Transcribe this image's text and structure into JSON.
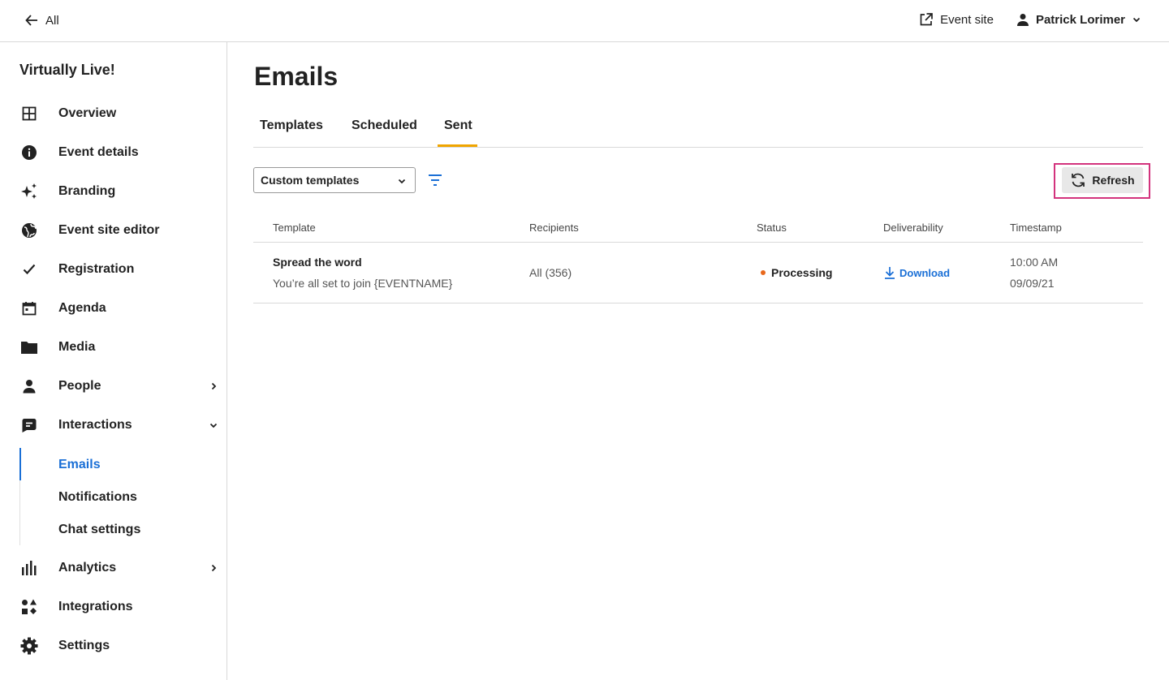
{
  "topbar": {
    "back_label": "All",
    "event_site_label": "Event site",
    "user_name": "Patrick Lorimer"
  },
  "sidebar": {
    "event_name": "Virtually Live!",
    "items": [
      {
        "label": "Overview",
        "icon": "grid-icon"
      },
      {
        "label": "Event details",
        "icon": "info-icon"
      },
      {
        "label": "Branding",
        "icon": "sparkle-icon"
      },
      {
        "label": "Event site editor",
        "icon": "globe-icon"
      },
      {
        "label": "Registration",
        "icon": "check-icon"
      },
      {
        "label": "Agenda",
        "icon": "calendar-icon"
      },
      {
        "label": "Media",
        "icon": "folder-icon"
      },
      {
        "label": "People",
        "icon": "person-icon"
      },
      {
        "label": "Interactions",
        "icon": "chat-icon"
      },
      {
        "label": "Analytics",
        "icon": "bar-chart-icon"
      },
      {
        "label": "Integrations",
        "icon": "shapes-icon"
      },
      {
        "label": "Settings",
        "icon": "gear-icon"
      }
    ],
    "sub_items": [
      "Emails",
      "Notifications",
      "Chat settings"
    ]
  },
  "main": {
    "title": "Emails",
    "tabs": [
      "Templates",
      "Scheduled",
      "Sent"
    ],
    "active_tab": "Sent",
    "filter_select_value": "Custom templates",
    "refresh_label": "Refresh",
    "columns": [
      "Template",
      "Recipients",
      "Status",
      "Deliverability",
      "Timestamp"
    ],
    "rows": [
      {
        "template_name": "Spread the word",
        "template_subject": "You’re all set to join {EVENTNAME}",
        "recipients": "All (356)",
        "status": "Processing",
        "deliverability": "Download",
        "time": "10:00 AM",
        "date": "09/09/21"
      }
    ]
  },
  "colors": {
    "accent_blue": "#1a6fd6",
    "tab_underline": "#f0a500",
    "status_processing": "#e8681c",
    "highlight_outline": "#d3337d"
  }
}
